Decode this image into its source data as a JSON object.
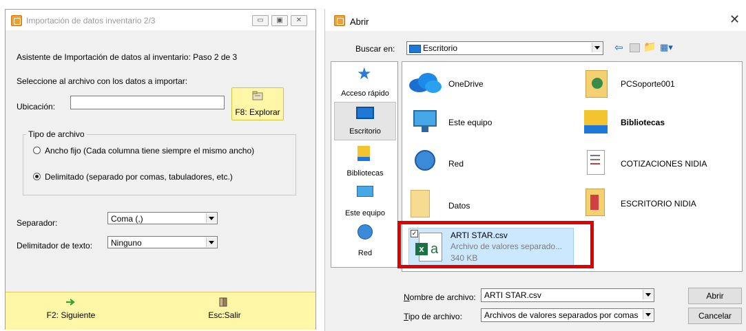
{
  "wizard": {
    "title": "Importación de datos inventario 2/3",
    "step_text": "Asistente de Importación de datos al inventario: Paso 2 de 3",
    "select_prompt": "Seleccione al archivo con los datos a importar:",
    "location_label": "Ubicación:",
    "location_value": "",
    "browse_button": "F8: Explorar",
    "file_type_group": "Tipo de archivo",
    "option_fixed": "Ancho fijo (Cada columna tiene siempre el mismo ancho)",
    "option_delimited": "Delimitado (separado por comas, tabuladores, etc.)",
    "selected_option": "delimited",
    "separator_label": "Separador:",
    "separator_value": "Coma (,)",
    "text_delimiter_label": "Delimitador de texto:",
    "text_delimiter_value": "Ninguno",
    "next_button": "F2: Siguiente",
    "exit_button": "Esc:Salir"
  },
  "dialog": {
    "title": "Abrir",
    "look_in_label": "Buscar en:",
    "look_in_value": "Escritorio",
    "places": [
      {
        "label": "Acceso rápido",
        "icon": "star-icon"
      },
      {
        "label": "Escritorio",
        "icon": "desktop-icon"
      },
      {
        "label": "Bibliotecas",
        "icon": "libraries-icon"
      },
      {
        "label": "Este equipo",
        "icon": "computer-icon"
      },
      {
        "label": "Red",
        "icon": "network-icon"
      }
    ],
    "items": [
      {
        "name": "OneDrive",
        "icon": "onedrive-icon"
      },
      {
        "name": "PCSoporte001",
        "icon": "user-folder-icon"
      },
      {
        "name": "Este equipo",
        "icon": "computer-icon"
      },
      {
        "name": "Bibliotecas",
        "icon": "libraries-icon"
      },
      {
        "name": "Red",
        "icon": "network-icon"
      },
      {
        "name": "COTIZACIONES NIDIA",
        "icon": "shortcut-document-icon"
      },
      {
        "name": "Datos",
        "icon": "folder-icon"
      },
      {
        "name": "ESCRITORIO NIDIA",
        "icon": "shortcut-folder-icon"
      }
    ],
    "selected_file": {
      "name": "ARTI STAR.csv",
      "type": "Archivo de valores separado...",
      "size": "340 KB"
    },
    "filename_label": "Nombre de archivo:",
    "filename_value": "ARTI STAR.csv",
    "filetype_label": "Tipo de archivo:",
    "filetype_value": "Archivos de valores separados por comas",
    "open_button": "Abrir",
    "cancel_button": "Cancelar",
    "highlight_color": "#e00000",
    "selection_color": "#cce8ff"
  }
}
